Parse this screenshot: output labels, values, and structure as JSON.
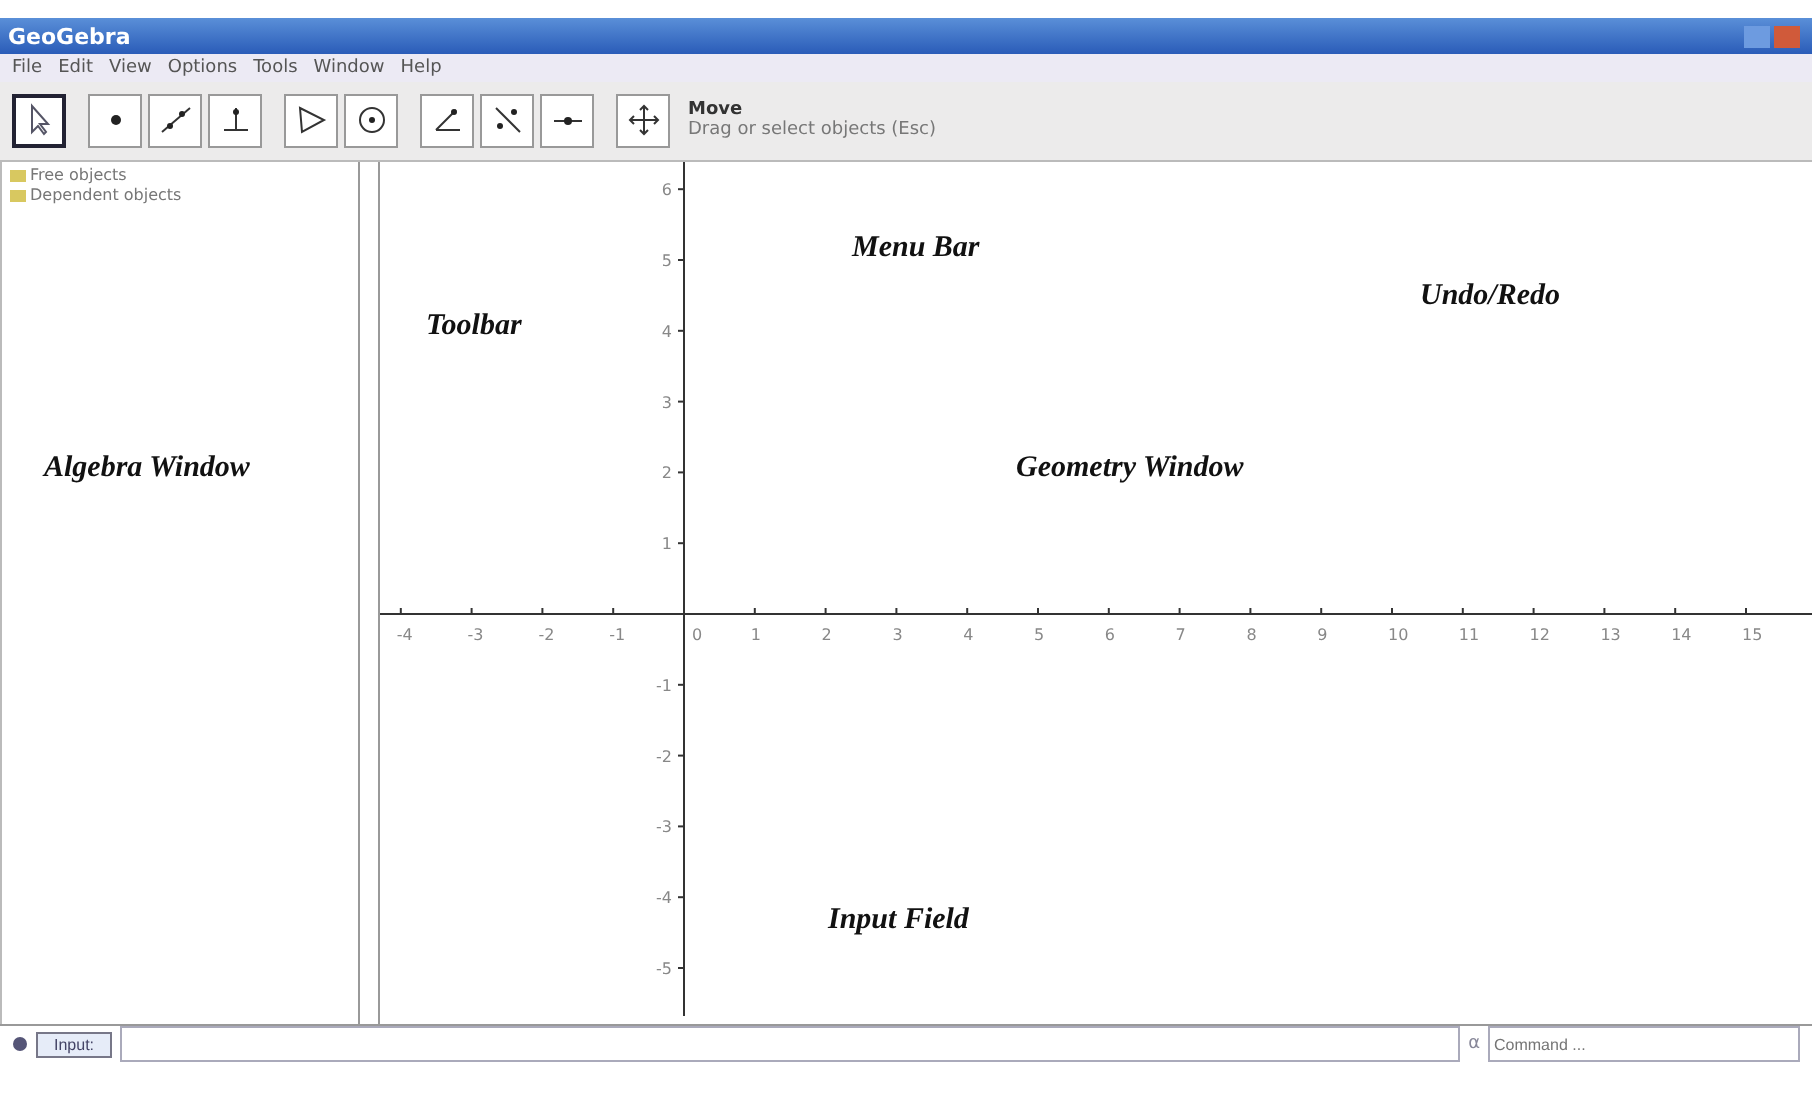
{
  "window": {
    "title": "GeoGebra"
  },
  "menu": [
    "File",
    "Edit",
    "View",
    "Options",
    "Tools",
    "Window",
    "Help"
  ],
  "toolbar": {
    "tools": [
      {
        "kind": "move",
        "selected": true
      },
      {
        "kind": "point",
        "selected": false
      },
      {
        "kind": "line",
        "selected": false
      },
      {
        "kind": "perpendicular",
        "selected": false
      },
      {
        "kind": "polygon",
        "selected": false
      },
      {
        "kind": "circle",
        "selected": false
      },
      {
        "kind": "angle",
        "selected": false
      },
      {
        "kind": "reflect",
        "selected": false
      },
      {
        "kind": "slider",
        "selected": false
      },
      {
        "kind": "pan",
        "selected": false
      }
    ],
    "tool_name": "Move",
    "tool_help": "Drag or select objects (Esc)"
  },
  "algebra": {
    "items": [
      {
        "label": "Free objects"
      },
      {
        "label": "Dependent objects"
      }
    ]
  },
  "geometry": {
    "x_labels": [
      "-4",
      "-3",
      "-2",
      "-1",
      "0",
      "1",
      "2",
      "3",
      "4",
      "5",
      "6",
      "7",
      "8",
      "9",
      "10",
      "11",
      "12",
      "13",
      "14",
      "15"
    ],
    "y_labels": [
      "6",
      "5",
      "4",
      "3",
      "2",
      "1",
      "-1",
      "-2",
      "-3",
      "-4",
      "-5"
    ]
  },
  "annotations": [
    "Menu Bar",
    "Toolbar",
    "Undo/Redo",
    "Algebra Window",
    "Geometry Window",
    "Input Field"
  ],
  "input_bar": {
    "button": "Input:",
    "symbol": "α",
    "command_placeholder": "Command ..."
  }
}
